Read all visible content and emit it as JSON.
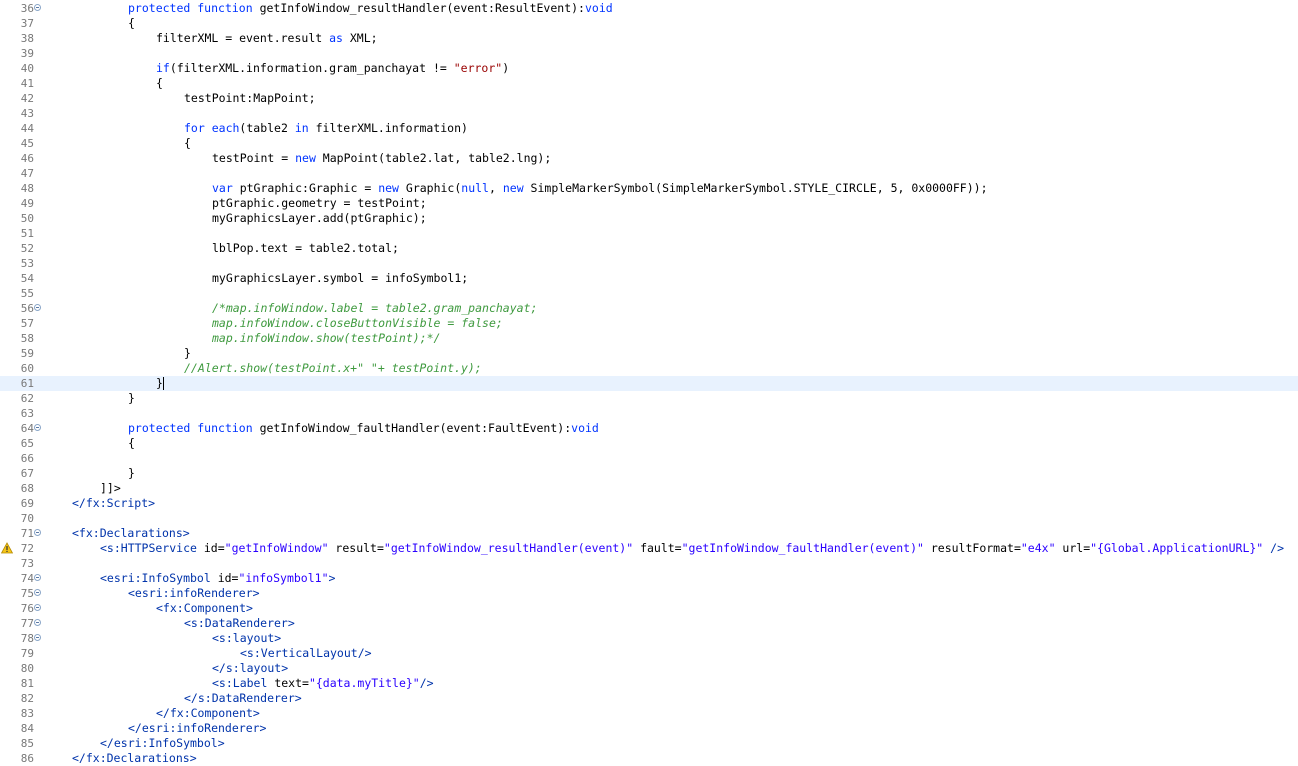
{
  "editor": {
    "lines": [
      {
        "n": "36",
        "fold": true,
        "indent": 12,
        "tokens": [
          [
            "kw",
            "protected"
          ],
          [
            "t",
            " "
          ],
          [
            "kw",
            "function"
          ],
          [
            "t",
            " getInfoWindow_resultHandler(event:ResultEvent):"
          ],
          [
            "kw",
            "void"
          ]
        ]
      },
      {
        "n": "37",
        "indent": 12,
        "tokens": [
          [
            "t",
            "{"
          ]
        ]
      },
      {
        "n": "38",
        "indent": 16,
        "tokens": [
          [
            "t",
            "filterXML = event.result "
          ],
          [
            "kw",
            "as"
          ],
          [
            "t",
            " XML;"
          ]
        ]
      },
      {
        "n": "39",
        "indent": 0,
        "tokens": []
      },
      {
        "n": "40",
        "indent": 16,
        "tokens": [
          [
            "kw",
            "if"
          ],
          [
            "t",
            "(filterXML.information.gram_panchayat != "
          ],
          [
            "str",
            "\"error\""
          ],
          [
            "t",
            ")"
          ]
        ]
      },
      {
        "n": "41",
        "indent": 16,
        "tokens": [
          [
            "t",
            "{"
          ]
        ]
      },
      {
        "n": "42",
        "indent": 20,
        "tokens": [
          [
            "t",
            "testPoint:MapPoint;"
          ]
        ]
      },
      {
        "n": "43",
        "indent": 0,
        "tokens": []
      },
      {
        "n": "44",
        "indent": 20,
        "tokens": [
          [
            "kw",
            "for"
          ],
          [
            "t",
            " "
          ],
          [
            "kw",
            "each"
          ],
          [
            "t",
            "(table2 "
          ],
          [
            "kw",
            "in"
          ],
          [
            "t",
            " filterXML.information)"
          ]
        ]
      },
      {
        "n": "45",
        "indent": 20,
        "tokens": [
          [
            "t",
            "{"
          ]
        ]
      },
      {
        "n": "46",
        "indent": 24,
        "tokens": [
          [
            "t",
            "testPoint = "
          ],
          [
            "kw",
            "new"
          ],
          [
            "t",
            " MapPoint(table2.lat, table2.lng);"
          ]
        ]
      },
      {
        "n": "47",
        "indent": 0,
        "tokens": []
      },
      {
        "n": "48",
        "indent": 24,
        "tokens": [
          [
            "kw",
            "var"
          ],
          [
            "t",
            " ptGraphic:Graphic = "
          ],
          [
            "kw",
            "new"
          ],
          [
            "t",
            " Graphic("
          ],
          [
            "kw",
            "null"
          ],
          [
            "t",
            ", "
          ],
          [
            "kw",
            "new"
          ],
          [
            "t",
            " SimpleMarkerSymbol(SimpleMarkerSymbol.STYLE_CIRCLE, 5, 0x0000FF));"
          ]
        ]
      },
      {
        "n": "49",
        "indent": 24,
        "tokens": [
          [
            "t",
            "ptGraphic.geometry = testPoint;"
          ]
        ]
      },
      {
        "n": "50",
        "indent": 24,
        "tokens": [
          [
            "t",
            "myGraphicsLayer.add(ptGraphic);"
          ]
        ]
      },
      {
        "n": "51",
        "indent": 0,
        "tokens": []
      },
      {
        "n": "52",
        "indent": 24,
        "tokens": [
          [
            "t",
            "lblPop.text = table2.total;"
          ]
        ]
      },
      {
        "n": "53",
        "indent": 0,
        "tokens": []
      },
      {
        "n": "54",
        "indent": 24,
        "tokens": [
          [
            "t",
            "myGraphicsLayer.symbol = infoSymbol1;"
          ]
        ]
      },
      {
        "n": "55",
        "indent": 0,
        "tokens": []
      },
      {
        "n": "56",
        "fold": true,
        "indent": 24,
        "tokens": [
          [
            "cm",
            "/*map.infoWindow.label = table2.gram_panchayat;"
          ]
        ]
      },
      {
        "n": "57",
        "indent": 24,
        "tokens": [
          [
            "cm",
            "map.infoWindow.closeButtonVisible = false;"
          ]
        ]
      },
      {
        "n": "58",
        "indent": 24,
        "tokens": [
          [
            "cm",
            "map.infoWindow.show(testPoint);*/"
          ]
        ]
      },
      {
        "n": "59",
        "indent": 20,
        "tokens": [
          [
            "t",
            "}"
          ]
        ]
      },
      {
        "n": "60",
        "indent": 20,
        "tokens": [
          [
            "cm",
            "//Alert.show(testPoint.x+\" \"+ testPoint.y);"
          ]
        ]
      },
      {
        "n": "61",
        "current": true,
        "caret": true,
        "indent": 16,
        "tokens": [
          [
            "t",
            "}"
          ]
        ]
      },
      {
        "n": "62",
        "indent": 12,
        "tokens": [
          [
            "t",
            "}"
          ]
        ]
      },
      {
        "n": "63",
        "indent": 0,
        "tokens": []
      },
      {
        "n": "64",
        "fold": true,
        "indent": 12,
        "tokens": [
          [
            "kw",
            "protected"
          ],
          [
            "t",
            " "
          ],
          [
            "kw",
            "function"
          ],
          [
            "t",
            " getInfoWindow_faultHandler(event:FaultEvent):"
          ],
          [
            "kw",
            "void"
          ]
        ]
      },
      {
        "n": "65",
        "indent": 12,
        "tokens": [
          [
            "t",
            "{"
          ]
        ]
      },
      {
        "n": "66",
        "indent": 0,
        "tokens": []
      },
      {
        "n": "67",
        "indent": 12,
        "tokens": [
          [
            "t",
            "}"
          ]
        ]
      },
      {
        "n": "68",
        "indent": 8,
        "tokens": [
          [
            "t",
            "]]>"
          ]
        ]
      },
      {
        "n": "69",
        "indent": 4,
        "tokens": [
          [
            "tag",
            "</fx:Script>"
          ]
        ]
      },
      {
        "n": "70",
        "indent": 0,
        "tokens": []
      },
      {
        "n": "71",
        "fold": true,
        "indent": 4,
        "tokens": [
          [
            "tag",
            "<fx:Declarations>"
          ]
        ]
      },
      {
        "n": "72",
        "warn": true,
        "indent": 8,
        "tokens": [
          [
            "tag",
            "<s:HTTPService"
          ],
          [
            "t",
            " id="
          ],
          [
            "val",
            "\"getInfoWindow\""
          ],
          [
            "t",
            " result="
          ],
          [
            "val",
            "\"getInfoWindow_resultHandler(event)\""
          ],
          [
            "t",
            " fault="
          ],
          [
            "val",
            "\"getInfoWindow_faultHandler(event)\""
          ],
          [
            "t",
            " resultFormat="
          ],
          [
            "val",
            "\"e4x\""
          ],
          [
            "t",
            " url="
          ],
          [
            "val",
            "\"{Global.ApplicationURL}\""
          ],
          [
            "t",
            " "
          ],
          [
            "tag",
            "/>"
          ]
        ]
      },
      {
        "n": "73",
        "indent": 0,
        "tokens": []
      },
      {
        "n": "74",
        "fold": true,
        "indent": 8,
        "tokens": [
          [
            "tag",
            "<esri:InfoSymbol"
          ],
          [
            "t",
            " id="
          ],
          [
            "val",
            "\"infoSymbol1\""
          ],
          [
            "tag",
            ">"
          ]
        ]
      },
      {
        "n": "75",
        "fold": true,
        "indent": 12,
        "tokens": [
          [
            "tag",
            "<esri:infoRenderer>"
          ]
        ]
      },
      {
        "n": "76",
        "fold": true,
        "indent": 16,
        "tokens": [
          [
            "tag",
            "<fx:Component>"
          ]
        ]
      },
      {
        "n": "77",
        "fold": true,
        "indent": 20,
        "tokens": [
          [
            "tag",
            "<s:DataRenderer>"
          ]
        ]
      },
      {
        "n": "78",
        "fold": true,
        "indent": 24,
        "tokens": [
          [
            "tag",
            "<s:layout>"
          ]
        ]
      },
      {
        "n": "79",
        "indent": 28,
        "tokens": [
          [
            "tag",
            "<s:VerticalLayout/>"
          ]
        ]
      },
      {
        "n": "80",
        "indent": 24,
        "tokens": [
          [
            "tag",
            "</s:layout>"
          ]
        ]
      },
      {
        "n": "81",
        "indent": 24,
        "tokens": [
          [
            "tag",
            "<s:Label"
          ],
          [
            "t",
            " text="
          ],
          [
            "val",
            "\"{data.myTitle}\""
          ],
          [
            "tag",
            "/>"
          ]
        ]
      },
      {
        "n": "82",
        "indent": 20,
        "tokens": [
          [
            "tag",
            "</s:DataRenderer>"
          ]
        ]
      },
      {
        "n": "83",
        "indent": 16,
        "tokens": [
          [
            "tag",
            "</fx:Component>"
          ]
        ]
      },
      {
        "n": "84",
        "indent": 12,
        "tokens": [
          [
            "tag",
            "</esri:infoRenderer>"
          ]
        ]
      },
      {
        "n": "85",
        "indent": 8,
        "tokens": [
          [
            "tag",
            "</esri:InfoSymbol>"
          ]
        ]
      },
      {
        "n": "86",
        "indent": 4,
        "tokens": [
          [
            "tag",
            "</fx:Declarations>"
          ]
        ]
      }
    ],
    "icons": {
      "fold": "fold-collapse-icon",
      "warning": "warning-icon"
    },
    "colors": {
      "keyword": "#0033ff",
      "string": "#990000",
      "comment": "#3f9a3f",
      "tag": "#0033aa",
      "current_line": "#e8f2fe"
    }
  }
}
